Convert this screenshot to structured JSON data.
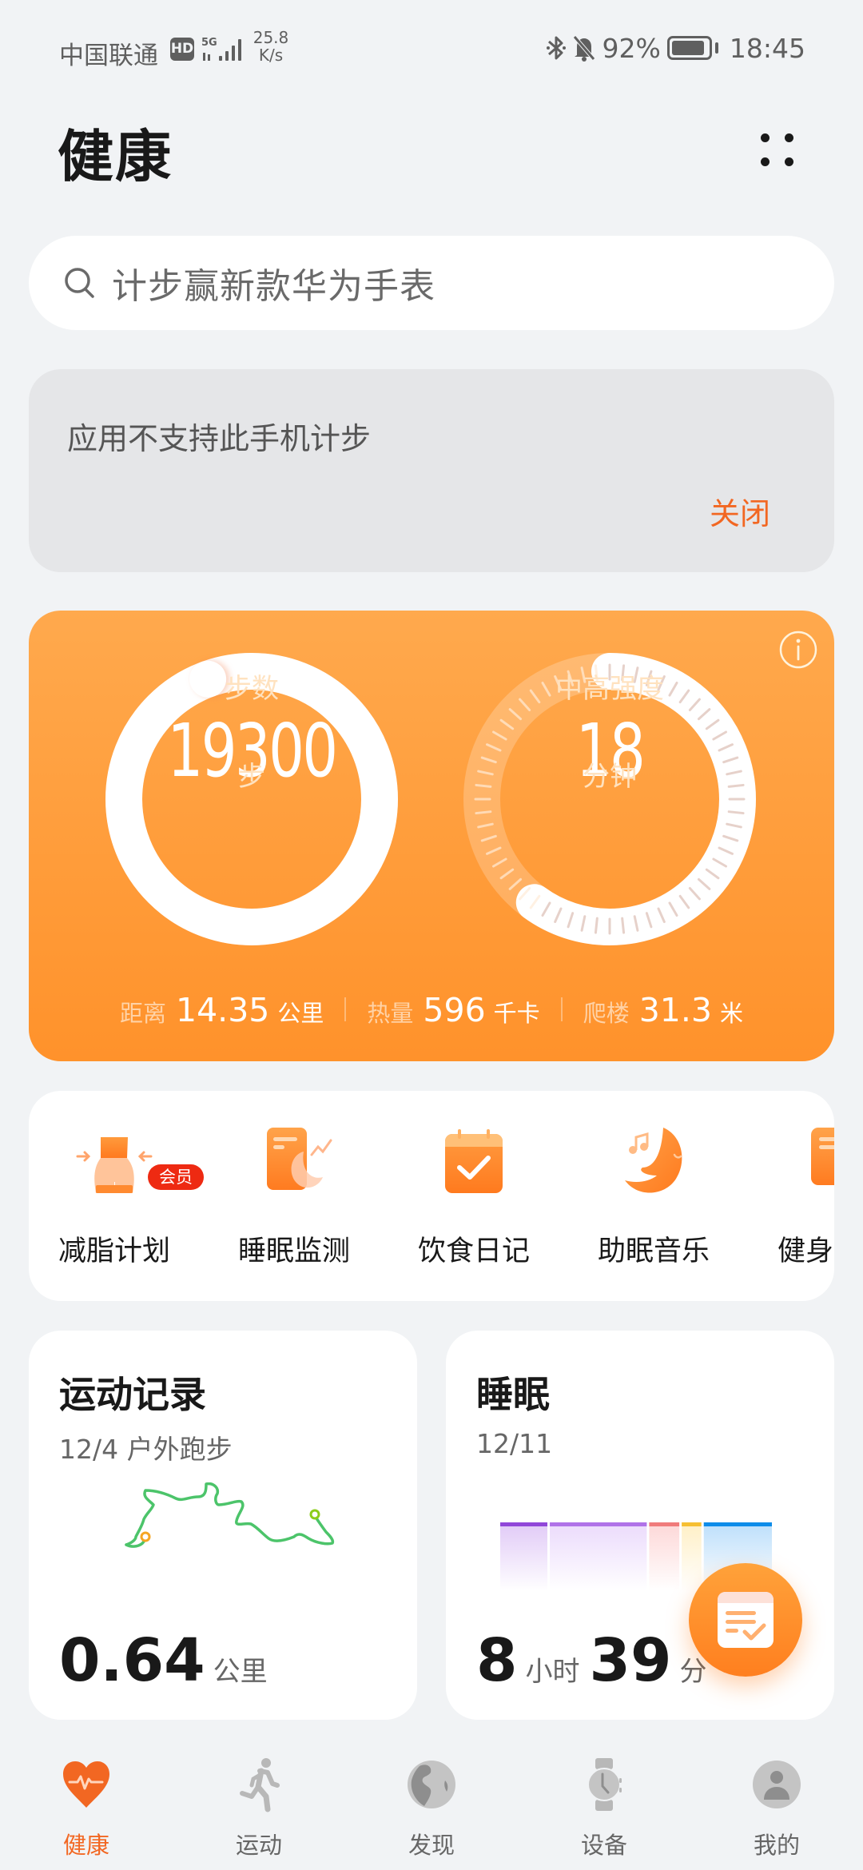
{
  "status_bar": {
    "carrier": "中国联通",
    "hd_badge": "HD",
    "network_type": "5G",
    "net_speed_value": "25.8",
    "net_speed_unit": "K/s",
    "battery_percent": "92%",
    "battery_level": 0.92,
    "time": "18:45",
    "icons": [
      "bluetooth-icon",
      "bell-muted-icon",
      "battery-icon",
      "signal-icon"
    ]
  },
  "header": {
    "title": "健康",
    "menu_icon": "four-dots-menu-icon"
  },
  "search": {
    "placeholder": "计步赢新款华为手表",
    "icon": "search-icon"
  },
  "notice": {
    "message": "应用不支持此手机计步",
    "close_label": "关闭"
  },
  "activity": {
    "steps": {
      "label": "步数",
      "value": "19300",
      "unit": "步",
      "goal_progress": 1.0
    },
    "intensity": {
      "label": "中高强度",
      "value": "18",
      "unit": "分钟",
      "goal_progress": 0.6
    },
    "stats": [
      {
        "label": "距离",
        "value": "14.35",
        "unit": "公里"
      },
      {
        "label": "热量",
        "value": "596",
        "unit": "千卡"
      },
      {
        "label": "爬楼",
        "value": "31.3",
        "unit": "米"
      }
    ],
    "info_icon": "info-icon"
  },
  "quick_entries": [
    {
      "label": "减脂计划",
      "icon": "body-shape-icon",
      "badge": "会员"
    },
    {
      "label": "睡眠监测",
      "icon": "sleep-monitor-icon"
    },
    {
      "label": "饮食日记",
      "icon": "calendar-check-icon"
    },
    {
      "label": "助眠音乐",
      "icon": "moon-music-icon"
    },
    {
      "label": "健身",
      "icon": "fitness-icon"
    }
  ],
  "exercise_card": {
    "title": "运动记录",
    "subtitle": "12/4 户外跑步",
    "distance_value": "0.64",
    "distance_unit": "公里",
    "route_colors": {
      "line": "#4cc46a",
      "start": "#8ccc1a",
      "end": "#f5a623"
    }
  },
  "sleep_card": {
    "title": "睡眠",
    "date": "12/11",
    "hours_value": "8",
    "hours_unit": "小时",
    "minutes_value": "39",
    "minutes_unit": "分",
    "segments": [
      {
        "share": 0.18,
        "color": "#9147d9",
        "fill": "#e2ccf7"
      },
      {
        "share": 0.37,
        "color": "#b072e8",
        "fill": "#ecdcfc"
      },
      {
        "share": 0.115,
        "color": "#f07b7b",
        "fill": "#fdd9d9"
      },
      {
        "share": 0.075,
        "color": "#f6bf32",
        "fill": "#fff0c8"
      },
      {
        "share": 0.26,
        "color": "#0d8ce9",
        "fill": "#bfe0fb"
      }
    ]
  },
  "fab": {
    "icon": "record-note-check-icon"
  },
  "bottom_nav": [
    {
      "label": "健康",
      "icon": "heart-pulse-icon",
      "active": true
    },
    {
      "label": "运动",
      "icon": "running-icon",
      "active": false
    },
    {
      "label": "发现",
      "icon": "globe-icon",
      "active": false
    },
    {
      "label": "设备",
      "icon": "watch-icon",
      "active": false
    },
    {
      "label": "我的",
      "icon": "profile-icon",
      "active": false
    }
  ],
  "colors": {
    "accent": "#f26722",
    "card_orange_top": "#ffa94d",
    "card_orange_bottom": "#ff922b",
    "background": "#f1f3f5"
  }
}
